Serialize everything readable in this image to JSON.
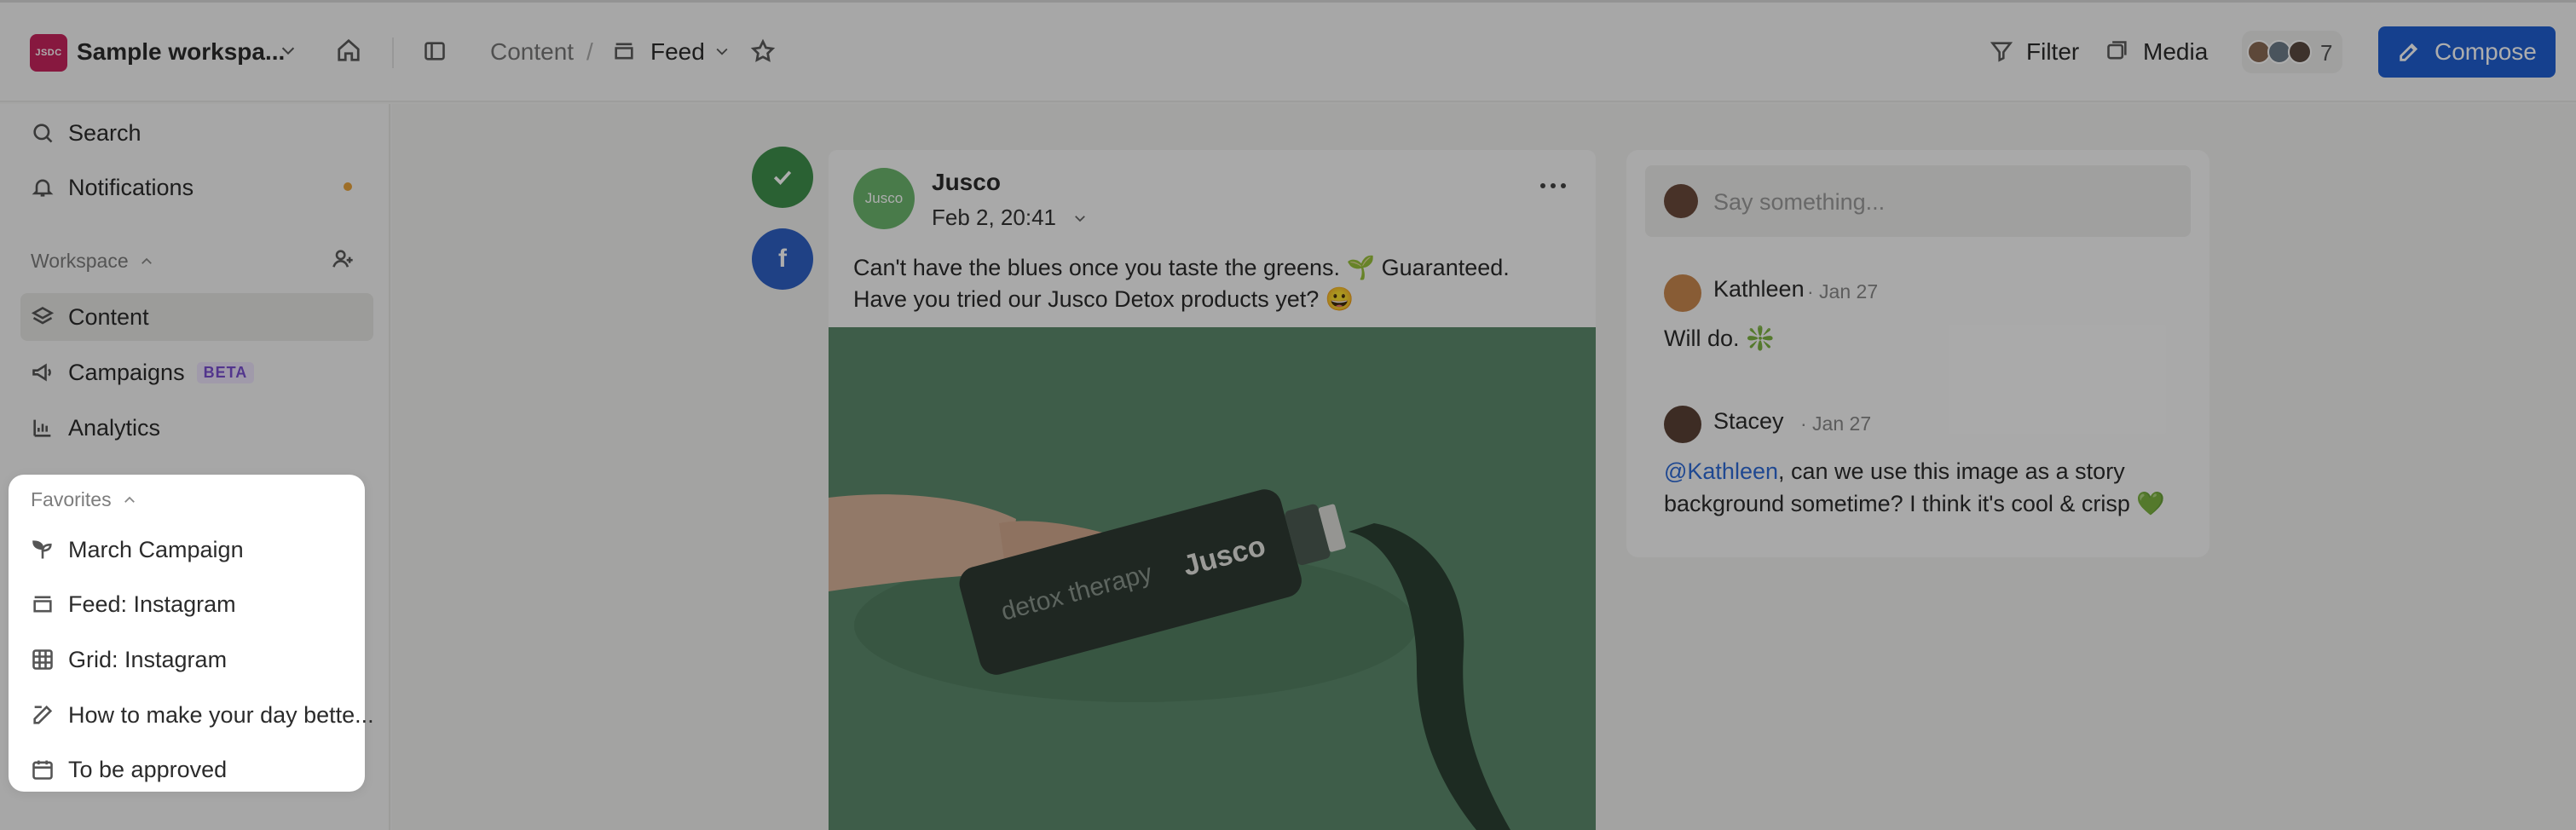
{
  "header": {
    "workspace_logo_text": "JSDC",
    "workspace_name": "Sample workspa...",
    "breadcrumb_content": "Content",
    "breadcrumb_separator": "/",
    "breadcrumb_feed": "Feed",
    "filter_label": "Filter",
    "media_label": "Media",
    "collaborators_count": "7",
    "compose_label": "Compose"
  },
  "sidebar": {
    "search_label": "Search",
    "notifications_label": "Notifications",
    "workspace_section": "Workspace",
    "items": [
      {
        "label": "Content",
        "icon": "layers-icon",
        "active": true
      },
      {
        "label": "Campaigns",
        "icon": "megaphone-icon",
        "badge": "BETA"
      },
      {
        "label": "Analytics",
        "icon": "bar-chart-icon"
      }
    ],
    "favorites_section": "Favorites",
    "favorites": [
      {
        "label": "March Campaign",
        "icon": "sprout-icon"
      },
      {
        "label": "Feed: Instagram",
        "icon": "feed-icon"
      },
      {
        "label": "Grid: Instagram",
        "icon": "grid-icon"
      },
      {
        "label": "How to make your day bette...",
        "icon": "edit-icon"
      },
      {
        "label": "To be approved",
        "icon": "calendar-icon"
      }
    ]
  },
  "post": {
    "avatar_text": "Jusco",
    "author": "Jusco",
    "date": "Feb 2, 20:41",
    "text_line1": "Can't have the blues once you taste the greens. 🌱 Guaranteed.",
    "text_line2": "Have you tried our Jusco Detox products yet? 😀",
    "image_bottle_brand": "Jusco",
    "image_bottle_text": "detox therapy"
  },
  "comments": {
    "placeholder": "Say something...",
    "items": [
      {
        "author": "Kathleen",
        "date": "· Jan 27",
        "text": "Will do. ❇️"
      },
      {
        "author": "Stacey",
        "date": "· Jan 27",
        "mention": "@Kathleen",
        "text_line1": ", can we use this image as a story",
        "text_line2": "background sometime? I think it's cool & crisp 💚"
      }
    ]
  },
  "colors": {
    "accent": "#1f5fd1",
    "workspace_logo": "#c8245d",
    "status_approved": "#3f8f4c",
    "facebook": "#2f61c4",
    "beta_badge": "#7a4fd0",
    "notification_dot": "#e8a23b"
  }
}
